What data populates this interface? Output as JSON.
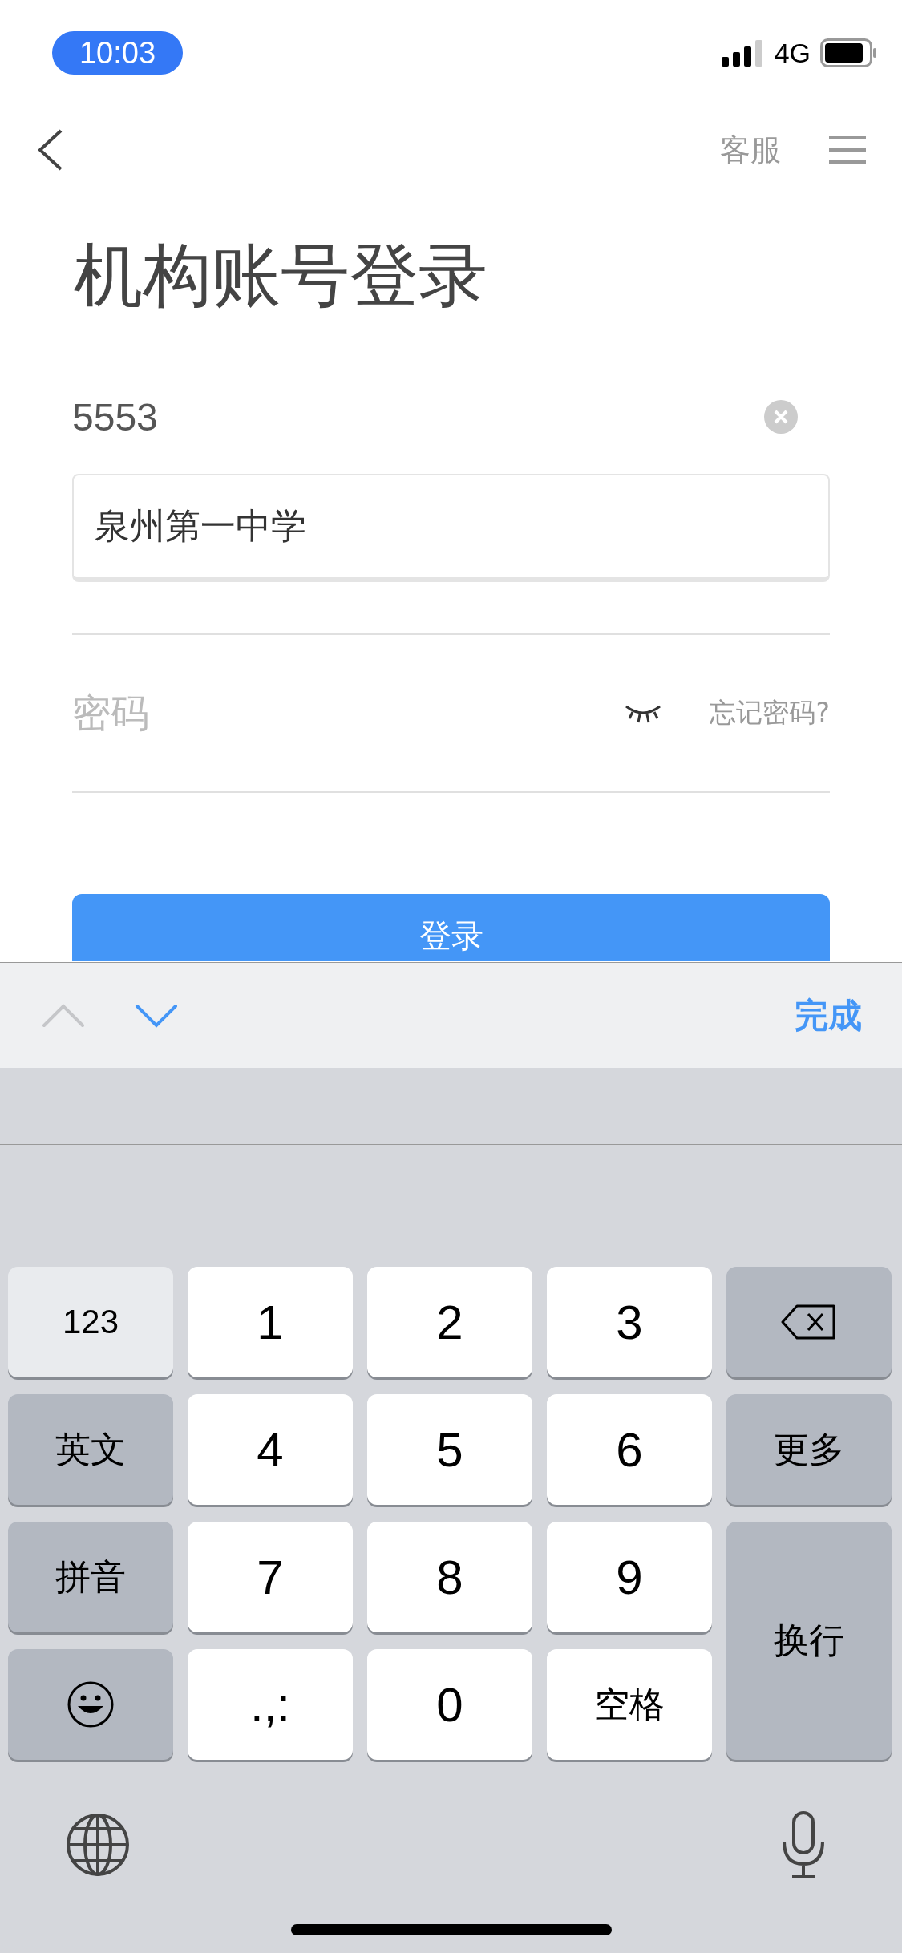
{
  "status_bar": {
    "time": "10:03",
    "network": "4G"
  },
  "nav": {
    "right_link": "客服"
  },
  "title": "机构账号登录",
  "account_field": {
    "value": "5553"
  },
  "suggestion": {
    "text": "泉州第一中学"
  },
  "password_field": {
    "placeholder": "密码",
    "forgot_link": "忘记密码?"
  },
  "login_button": {
    "label": "登录"
  },
  "keyboard_toolbar": {
    "prev_disabled": true,
    "next_disabled": false,
    "done": "完成"
  },
  "keyboard": {
    "keys": [
      {
        "label": "123",
        "kind": "mode"
      },
      {
        "label": "1",
        "kind": "digit"
      },
      {
        "label": "2",
        "kind": "digit"
      },
      {
        "label": "3",
        "kind": "digit"
      },
      {
        "kind": "backspace"
      },
      {
        "label": "英文",
        "kind": "function"
      },
      {
        "label": "4",
        "kind": "digit"
      },
      {
        "label": "5",
        "kind": "digit"
      },
      {
        "label": "6",
        "kind": "digit"
      },
      {
        "label": "更多",
        "kind": "function"
      },
      {
        "label": "拼音",
        "kind": "function"
      },
      {
        "label": "7",
        "kind": "digit"
      },
      {
        "label": "8",
        "kind": "digit"
      },
      {
        "label": "9",
        "kind": "digit"
      },
      {
        "label": "换行",
        "kind": "return"
      },
      {
        "kind": "emoji"
      },
      {
        "label": ".,:",
        "kind": "digit"
      },
      {
        "label": "0",
        "kind": "digit"
      },
      {
        "label": "空格",
        "kind": "space"
      }
    ]
  }
}
